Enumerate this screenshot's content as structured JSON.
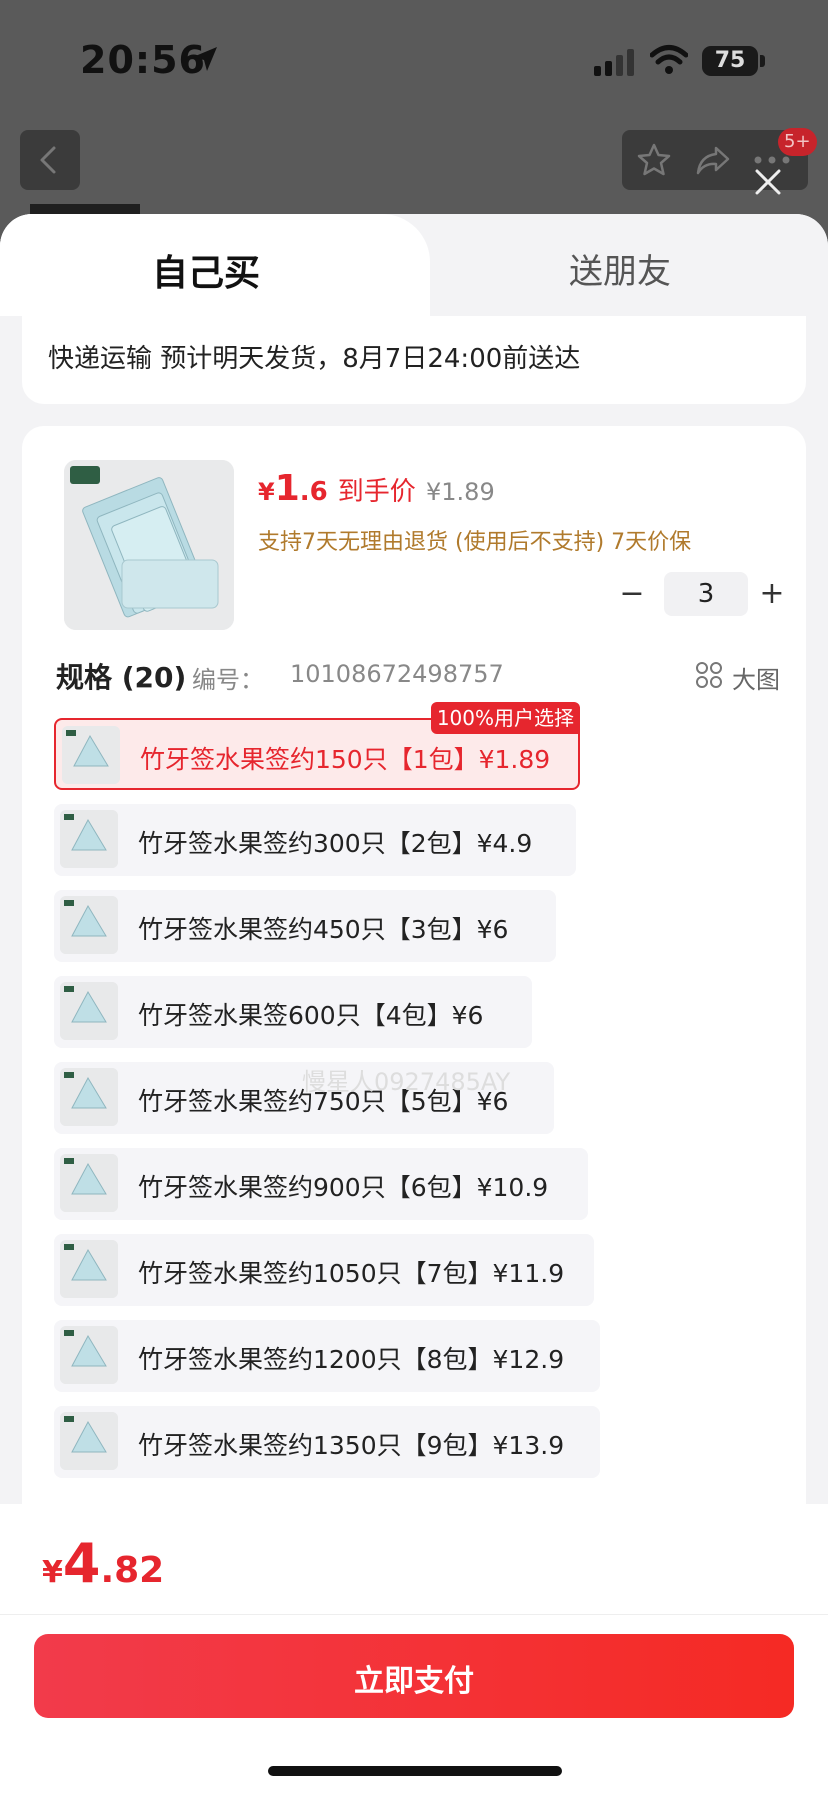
{
  "status_bar": {
    "time": "20:56",
    "battery": "75"
  },
  "header": {
    "badge": "5+"
  },
  "tabs": {
    "own": "自己买",
    "gift": "送朋友"
  },
  "delivery": {
    "text": "快递运输 预计明天发货，8月7日24:00前送达"
  },
  "product": {
    "price_currency": "¥",
    "price_int": "1",
    "price_dec": ".6",
    "price_tag": "到手价",
    "original_price": "¥1.89",
    "service_text": "支持7天无理由退货 (使用后不支持)  7天价保",
    "quantity": "3",
    "minus": "−",
    "plus": "+"
  },
  "spec": {
    "title": "规格 (20)",
    "code_label": "编号：",
    "code": "10108672498757",
    "big_image_label": "大图",
    "options": [
      {
        "label": "竹牙签水果签约150只【1包】¥1.89",
        "selected": true,
        "badge": "100%用户选择"
      },
      {
        "label": "竹牙签水果签约300只【2包】¥4.9"
      },
      {
        "label": "竹牙签水果签约450只【3包】¥6"
      },
      {
        "label": "竹牙签水果签600只【4包】¥6"
      },
      {
        "label": "竹牙签水果签约750只【5包】¥6"
      },
      {
        "label": "竹牙签水果签约900只【6包】¥10.9"
      },
      {
        "label": "竹牙签水果签约1050只【7包】¥11.9"
      },
      {
        "label": "竹牙签水果签约1200只【8包】¥12.9"
      },
      {
        "label": "竹牙签水果签约1350只【9包】¥13.9"
      }
    ]
  },
  "watermark": "慢星人0927485AY",
  "footer": {
    "total_currency": "¥",
    "total_int": "4",
    "total_dec": ".82",
    "pay_label": "立即支付"
  },
  "colors": {
    "accent": "#e6262e",
    "service": "#b07a2c"
  }
}
